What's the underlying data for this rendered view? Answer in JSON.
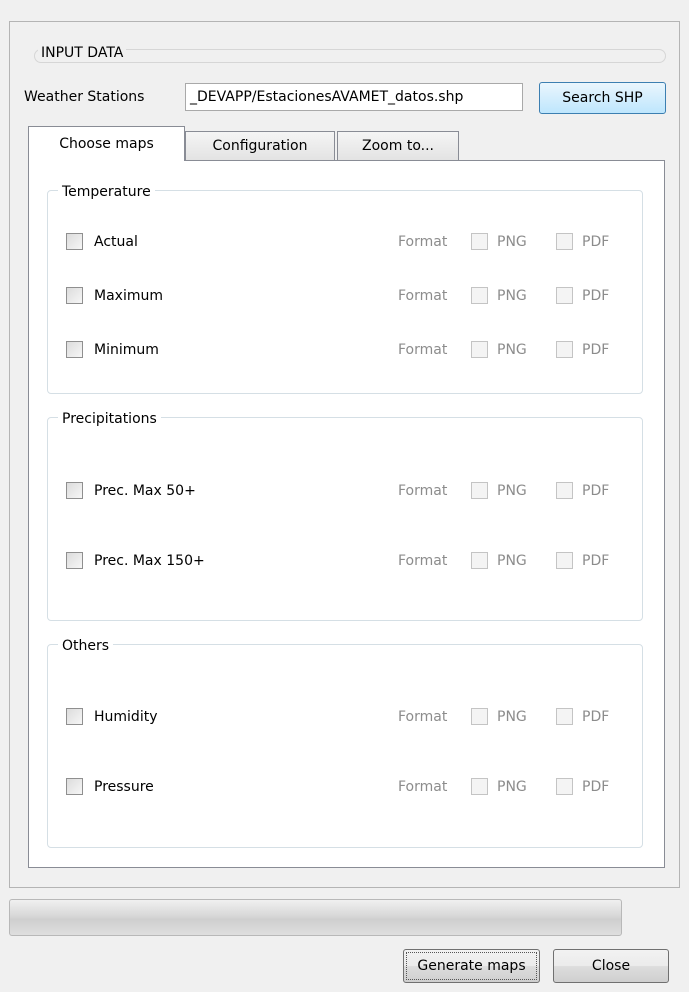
{
  "input_group": {
    "title": "INPUT DATA"
  },
  "weather_stations": {
    "label": "Weather Stations",
    "value": "_DEVAPP/EstacionesAVAMET_datos.shp",
    "button": "Search SHP"
  },
  "tabs": [
    {
      "label": "Choose maps",
      "active": true
    },
    {
      "label": "Configuration",
      "active": false
    },
    {
      "label": "Zoom to...",
      "active": false
    }
  ],
  "format": {
    "label": "Format",
    "png": "PNG",
    "pdf": "PDF"
  },
  "temperature": {
    "title": "Temperature",
    "items": [
      {
        "label": "Actual",
        "checked": false
      },
      {
        "label": "Maximum",
        "checked": false
      },
      {
        "label": "Minimum",
        "checked": false
      }
    ]
  },
  "precipitations": {
    "title": "Precipitations",
    "items": [
      {
        "label": "Prec. Max 50+",
        "checked": false
      },
      {
        "label": "Prec. Max 150+",
        "checked": false
      }
    ]
  },
  "others": {
    "title": "Others",
    "items": [
      {
        "label": "Humidity",
        "checked": false
      },
      {
        "label": "Pressure",
        "checked": false
      }
    ]
  },
  "progress": {
    "value": 0
  },
  "buttons": {
    "generate": "Generate maps",
    "close": "Close"
  }
}
